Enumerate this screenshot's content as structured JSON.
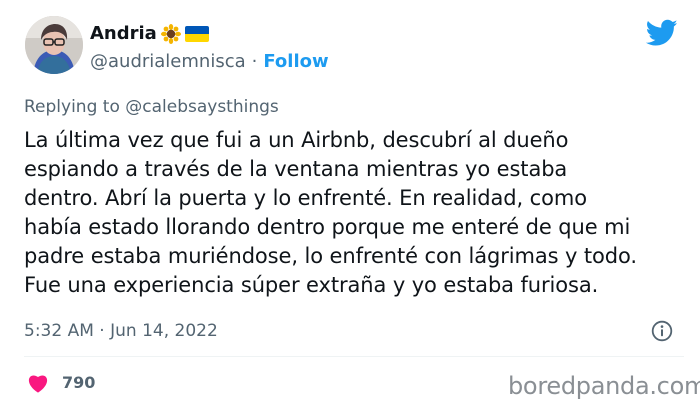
{
  "author": {
    "name": "Andria",
    "handle": "@audrialemnisca",
    "follow_label": "Follow",
    "separator": "·"
  },
  "reply": {
    "prefix": "Replying to",
    "mention": "@calebsaysthings"
  },
  "tweet": {
    "lines": [
      "La última vez que fui a un Airbnb, descubrí al dueño",
      "espiando a través de la ventana mientras yo estaba",
      "dentro. Abrí la puerta y lo enfrenté. En realidad, como",
      "había estado llorando dentro porque me enteré de que mi",
      "padre estaba muriéndose, lo enfrenté con lágrimas y todo.",
      "Fue una experiencia súper extraña y yo estaba furiosa."
    ],
    "time": "5:32 AM",
    "date": "Jun 14, 2022",
    "separator": "·"
  },
  "stats": {
    "likes": "790"
  },
  "watermark": "boredpanda.com",
  "icons": {
    "brand": "twitter-bird-icon",
    "info": "info-icon",
    "like": "heart-icon",
    "emoji": "sunflower-icon",
    "flag": "ukraine-flag-icon"
  },
  "colors": {
    "link": "#1d9bf0",
    "secondary_text": "#536471",
    "primary_text": "#0f1419",
    "heart": "#f91880",
    "flag_blue": "#0057b7",
    "flag_yellow": "#ffd700"
  }
}
